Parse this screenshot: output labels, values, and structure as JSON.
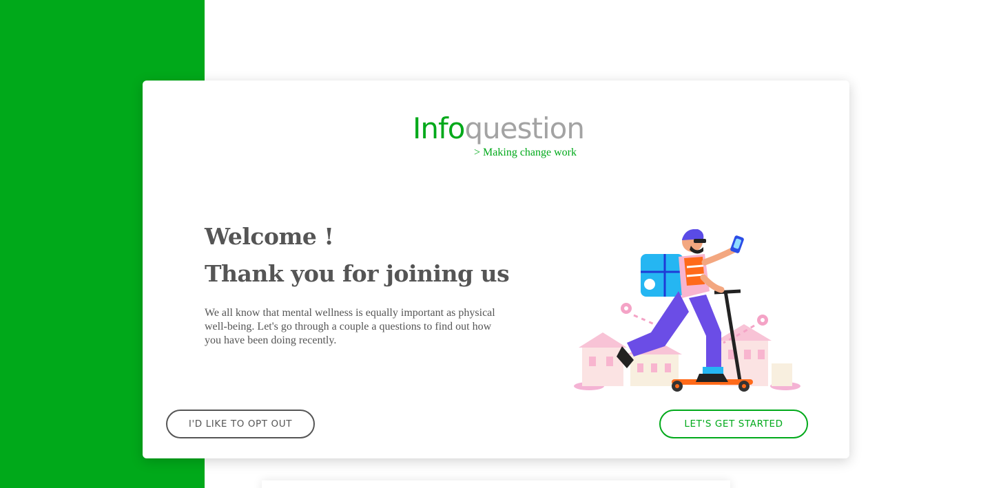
{
  "brand": {
    "name_part1": "Info",
    "name_part2": "question",
    "tagline": "> Making change work",
    "primary_color": "#00a91a",
    "secondary_color": "#a3a3a3"
  },
  "welcome": {
    "line1": "Welcome !",
    "line2": "Thank you for joining us"
  },
  "intro": {
    "text": "We all know that mental wellness is equally important as physical well-being. Let's go through a couple a questions to find out how you have been doing recently."
  },
  "actions": {
    "opt_out_label": "I'D LIKE TO OPT OUT",
    "start_label": "LET'S GET STARTED"
  },
  "illustration": {
    "icon": "scooter-delivery-illustration"
  }
}
